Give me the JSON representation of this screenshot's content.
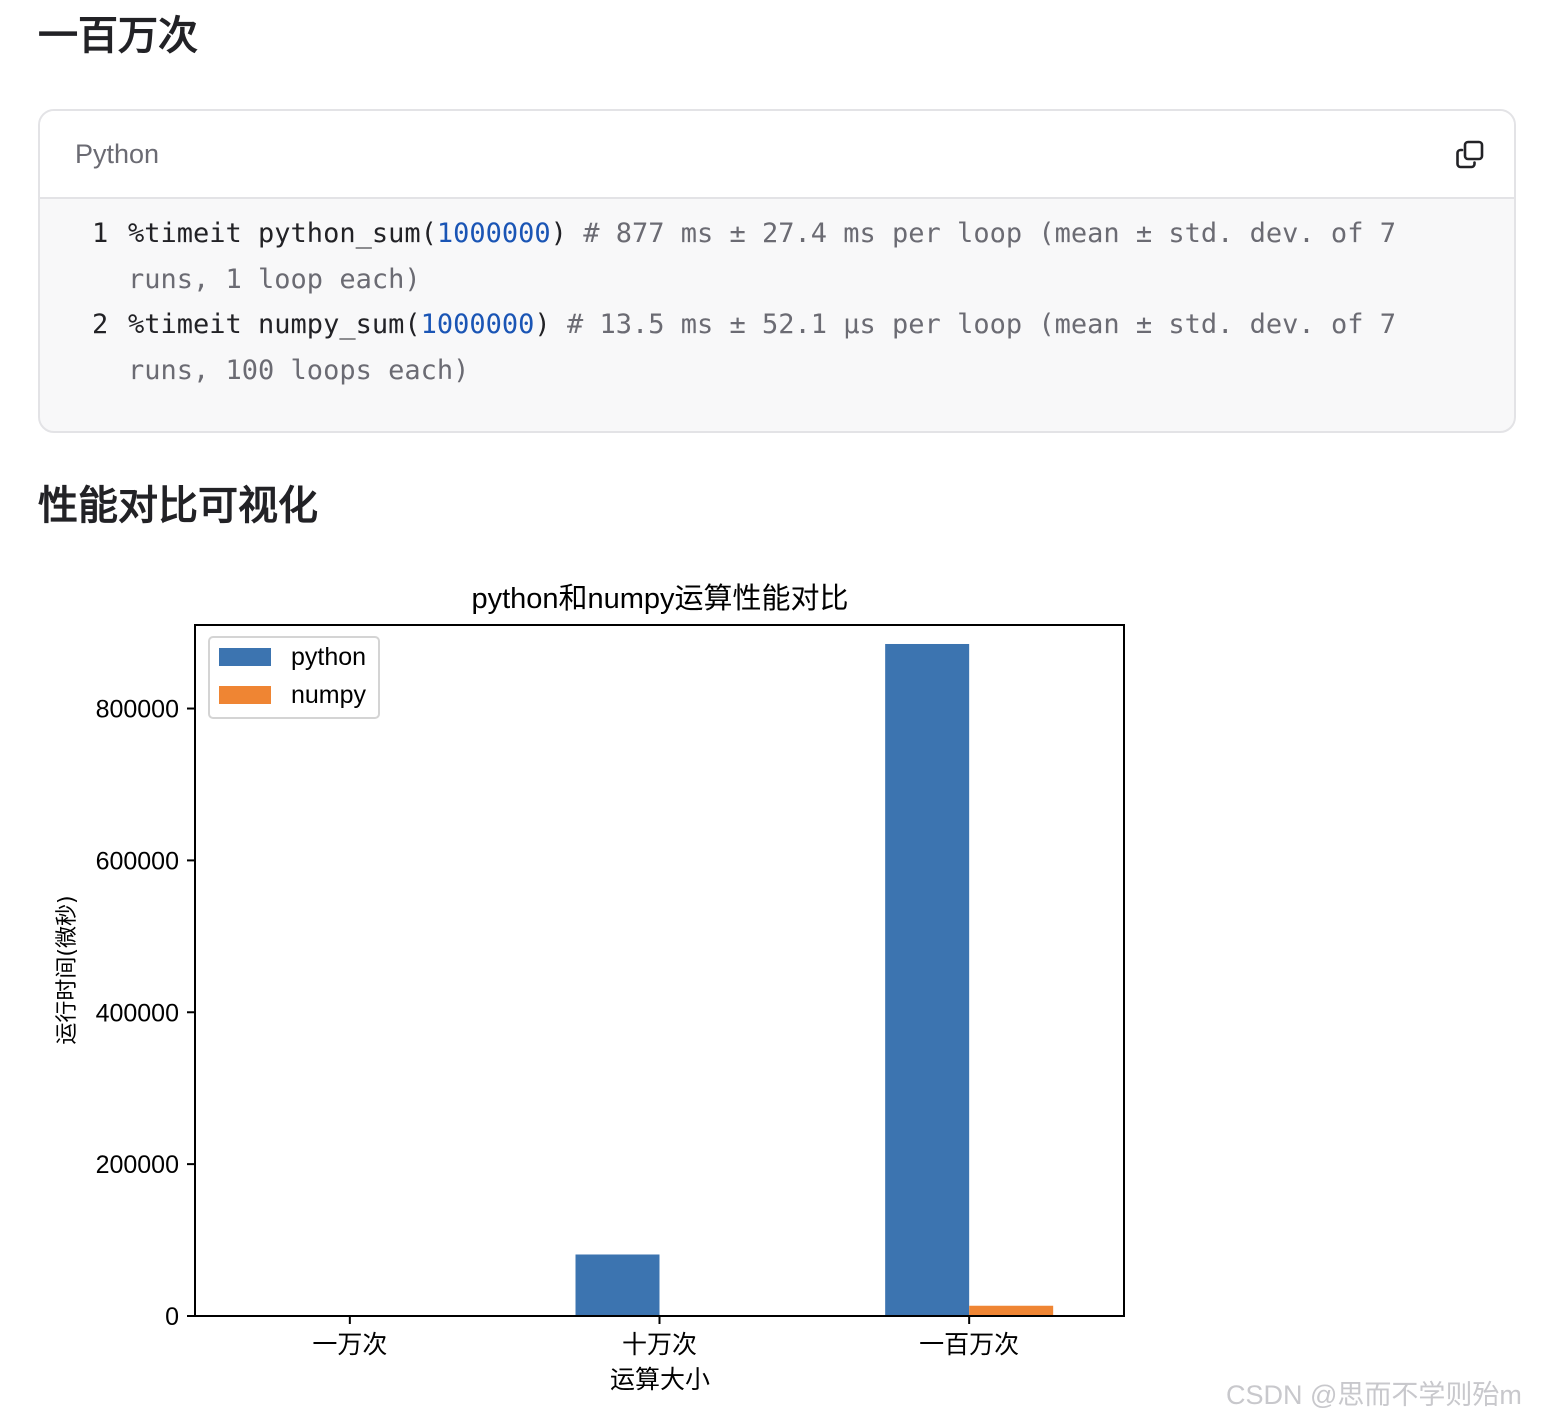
{
  "sections": {
    "million_heading": "一百万次",
    "visual_heading": "性能对比可视化"
  },
  "code_block": {
    "language": "Python",
    "lines": [
      {
        "number": "1",
        "prefix": "%timeit python_sum(",
        "number_arg": "1000000",
        "suffix": ")",
        "comment": "# 877 ms ± 27.4 ms per loop (mean ± std. dev. of 7 runs, 1 loop each)"
      },
      {
        "number": "2",
        "prefix": "%timeit numpy_sum(",
        "number_arg": "1000000",
        "suffix": ")",
        "comment": "# 13.5 ms ± 52.1 µs per loop (mean ± std. dev. of 7 runs, 100 loops each)"
      }
    ]
  },
  "chart_data": {
    "type": "bar",
    "title": "python和numpy运算性能对比",
    "xlabel": "运算大小",
    "ylabel": "运行时间(微秒)",
    "categories": [
      "一万次",
      "十万次",
      "一百万次"
    ],
    "series": [
      {
        "name": "python",
        "values": [
          800,
          81000,
          885000
        ],
        "color": "#3c74b0"
      },
      {
        "name": "numpy",
        "values": [
          90,
          1200,
          13500
        ],
        "color": "#ef8533"
      }
    ],
    "ylim": [
      0,
      910000
    ],
    "yticks": [
      0,
      200000,
      400000,
      600000,
      800000
    ],
    "ytick_labels": [
      "0",
      "200000",
      "400000",
      "600000",
      "800000"
    ],
    "legend_position": "top-left",
    "grid": false
  },
  "watermark": "CSDN @思而不学则殆m"
}
